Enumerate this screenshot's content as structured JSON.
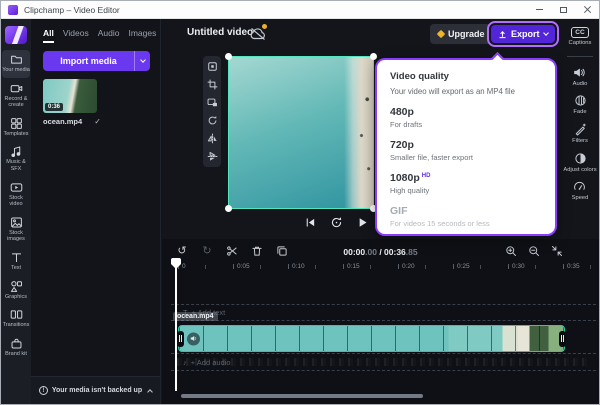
{
  "titlebar": {
    "title": "Clipchamp – Video Editor"
  },
  "nav": {
    "items": [
      {
        "label": "Your media",
        "icon": "folder",
        "active": true
      },
      {
        "label": "Record & create",
        "icon": "camera"
      },
      {
        "label": "Templates",
        "icon": "grid"
      },
      {
        "label": "Music & SFX",
        "icon": "music-note"
      },
      {
        "label": "Stock video",
        "icon": "video"
      },
      {
        "label": "Stock images",
        "icon": "image"
      },
      {
        "label": "Text",
        "icon": "text"
      },
      {
        "label": "Graphics",
        "icon": "shapes"
      },
      {
        "label": "Transitions",
        "icon": "transition"
      },
      {
        "label": "Brand kit",
        "icon": "briefcase"
      }
    ]
  },
  "media": {
    "tabs": [
      "All",
      "Videos",
      "Audio",
      "Images"
    ],
    "active_tab": "All",
    "import_label": "Import media",
    "clip_name": "ocean.mp4",
    "clip_duration": "0:36",
    "backup_notice": "Your media isn't backed up"
  },
  "header": {
    "project_title": "Untitled video",
    "upgrade_label": "Upgrade",
    "export_label": "Export"
  },
  "export_menu": {
    "title": "Video quality",
    "subtitle": "Your video will export as an MP4 file",
    "options": [
      {
        "label": "480p",
        "badge": "",
        "desc": "For drafts"
      },
      {
        "label": "720p",
        "badge": "",
        "desc": "Smaller file, faster export"
      },
      {
        "label": "1080p",
        "badge": "HD",
        "desc": "High quality"
      },
      {
        "label": "GIF",
        "badge": "",
        "desc": "For videos 15 seconds or less"
      }
    ]
  },
  "transport": {
    "current": "00:00",
    "current_frac": ".00",
    "separator": " / ",
    "total": "00:36",
    "total_frac": ".85"
  },
  "right_tools": [
    "Captions",
    "Audio",
    "Fade",
    "Filters",
    "Adjust colors",
    "Speed"
  ],
  "timeline": {
    "ruler": [
      "0",
      "0:05",
      "0:10",
      "0:15",
      "0:20",
      "0:25",
      "0:30",
      "0:35"
    ],
    "clip_tag": "ocean.mp4",
    "add_text": "+ Add text",
    "add_audio": "+ Add audio"
  },
  "glyphs": {
    "undo": "↺",
    "redo": "↻",
    "check": "✓",
    "text_tool": "T",
    "music_note": "♪",
    "cc": "CC",
    "info": "!"
  },
  "colors": {
    "brand_purple": "#6a38ef",
    "export_purple": "#5226d8",
    "highlight_ring": "#b46eff",
    "panel_border": "#8b3dff",
    "selection_mint": "#17d3a6",
    "warning_yellow": "#edb02b"
  }
}
